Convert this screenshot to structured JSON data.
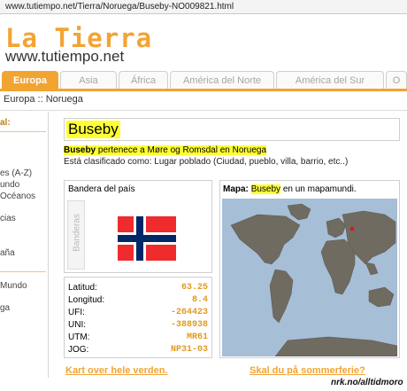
{
  "browser": {
    "url": "www.tutiempo.net/Tierra/Noruega/Buseby-NO009821.html"
  },
  "header": {
    "logo": "La Tierra",
    "site": "www.tutiempo.net"
  },
  "tabs": [
    {
      "label": "Europa",
      "active": true
    },
    {
      "label": "Asia",
      "active": false
    },
    {
      "label": "África",
      "active": false
    },
    {
      "label": "América del Norte",
      "active": false
    },
    {
      "label": "América del Sur",
      "active": false
    },
    {
      "label": "O",
      "active": false
    }
  ],
  "breadcrumb": "Europa :: Noruega",
  "sidebar": {
    "title": "al:",
    "items": [
      "es (A-Z)",
      "undo",
      "Océanos",
      "cias",
      "aña",
      "Mundo",
      "ga"
    ]
  },
  "place": {
    "title": "Buseby",
    "desc_name": "Buseby",
    "desc_rest": " pertenece a Møre og Romsdal en Noruega",
    "desc_class": "Está clasificado como: Lugar poblado (Ciudad, pueblo, villa, barrio, etc..)"
  },
  "flag_panel": {
    "heading": "Bandera del país",
    "vertical_tab": "Banderas"
  },
  "coordinates": [
    {
      "label": "Latitud:",
      "value": "63.25"
    },
    {
      "label": "Longitud:",
      "value": "8.4"
    },
    {
      "label": "UFI:",
      "value": "-264423"
    },
    {
      "label": "UNI:",
      "value": "-388938"
    },
    {
      "label": "UTM:",
      "value": "MR61"
    },
    {
      "label": "JOG:",
      "value": "NP31-03"
    }
  ],
  "map_panel": {
    "prefix": "Mapa:",
    "name": "Buseby",
    "suffix": " en un mapamundi."
  },
  "links": {
    "left": "Kart over hele verden.",
    "right": "Skal du på sommerferie?"
  },
  "watermark": "nrk.no/alltidmoro",
  "colors": {
    "accent": "#f2a433",
    "highlight": "#ffff33",
    "ocean": "#a6bed6",
    "land": "#6f6b60"
  }
}
